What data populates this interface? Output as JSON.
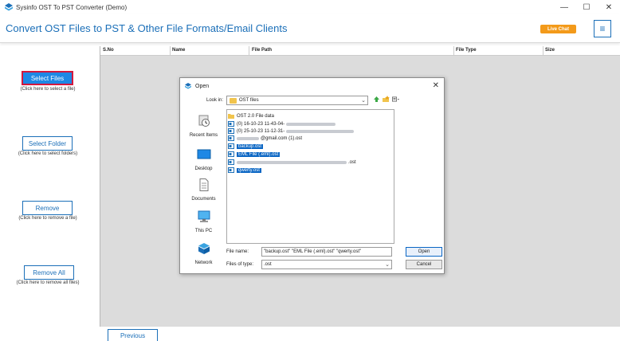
{
  "window": {
    "title": "Sysinfo OST To PST Converter (Demo)",
    "controls": {
      "minimize": "—",
      "maximize": "☐",
      "close": "✕"
    }
  },
  "header": {
    "title": "Convert OST Files to PST & Other File Formats/Email Clients",
    "live_chat": "Live Chat",
    "menu_icon": "≡"
  },
  "left_panel": {
    "select_files": {
      "label": "Select Files",
      "hint": "(Click here to select a file)"
    },
    "select_folder": {
      "label": "Select Folder",
      "hint": "(Click here to select folders)"
    },
    "remove": {
      "label": "Remove",
      "hint": "(Click here to remove a file)"
    },
    "remove_all": {
      "label": "Remove All",
      "hint": "(Click here to remove all files)"
    }
  },
  "table": {
    "columns": [
      "S.No",
      "Name",
      "File Path",
      "File Type",
      "Size"
    ]
  },
  "footer": {
    "previous": "Previous"
  },
  "dialog": {
    "title": "Open",
    "close": "✕",
    "look_in_label": "Look in:",
    "look_in_value": "OST files",
    "places": [
      "Recent Items",
      "Desktop",
      "Documents",
      "This PC",
      "Network"
    ],
    "files": [
      {
        "name": "OST 2.0 File data",
        "type": "folder",
        "selected": false
      },
      {
        "name": "(0) 16-10-23 11-43-04-",
        "type": "ost",
        "selected": false
      },
      {
        "name": "(0) 25-10-23 11-12-31-",
        "type": "ost",
        "selected": false
      },
      {
        "name": "@gmail.com (1).ost",
        "type": "ost",
        "selected": false
      },
      {
        "name": "backup.ost",
        "type": "ost",
        "selected": true
      },
      {
        "name": "EML File (.eml).ost",
        "type": "ost",
        "selected": true
      },
      {
        "name": ".ost",
        "type": "ost",
        "selected": false
      },
      {
        "name": "qwerty.ost",
        "type": "ost",
        "selected": true
      }
    ],
    "file_name_label": "File name:",
    "file_name_value": "\"backup.ost\" \"EML File (.eml).ost\" \"qwerty.ost\"",
    "files_of_type_label": "Files of type:",
    "files_of_type_value": ".ost",
    "open_button": "Open",
    "cancel_button": "Cancel"
  },
  "colors": {
    "brand_blue": "#1b6fb8",
    "accent_orange": "#f39a1a",
    "selection_blue": "#0a66c4",
    "highlight_red": "#d4183d"
  }
}
